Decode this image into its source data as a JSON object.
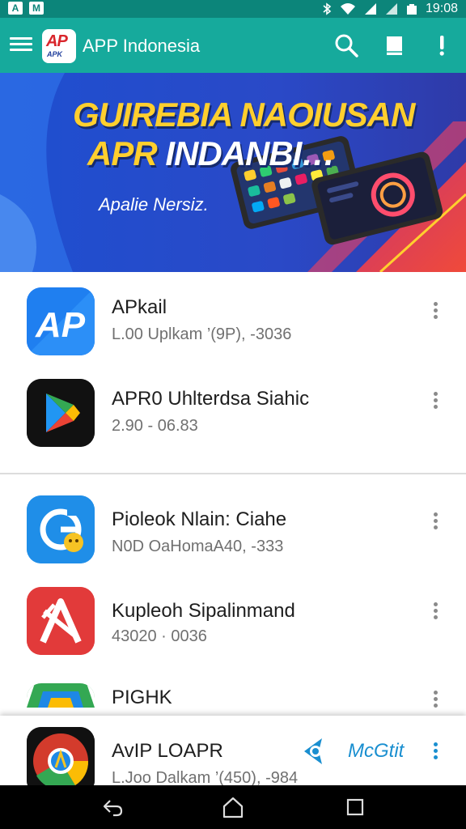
{
  "status_bar": {
    "left_glyphs": [
      "A",
      "M"
    ],
    "time": "19:08"
  },
  "app_bar": {
    "logo_text": "AP",
    "logo_subtext": "APK",
    "title": "APP Indonesia",
    "icons": [
      "menu-icon",
      "search-icon",
      "book-icon",
      "alert-icon"
    ]
  },
  "banner": {
    "line1": "GUIREBIA NAOIUSAN",
    "line2_a": "APR ",
    "line2_b": "INDANBI…",
    "subtitle": "Apalie Nersiz."
  },
  "apps": [
    {
      "name": "APkail",
      "meta": "L.00 Uplkam ’(9P), -3036",
      "icon": "ap-icon",
      "color": "#1f7ff0"
    },
    {
      "name": "APR0 Uhlterdsa Siahic",
      "meta": "2.90 - 06.83",
      "icon": "play-store-icon",
      "color": "#111111"
    },
    {
      "name": "Pioleok Nlain: Ciahe",
      "meta": "N0D OaHomaA40, -333",
      "icon": "g-emoji-icon",
      "color": "#1f8ee8"
    },
    {
      "name": "Kupleoh Sipalinmand",
      "meta": "43020 · 0036",
      "icon": "a-letter-icon",
      "color": "#e23a3a"
    },
    {
      "name": "PIGHK",
      "meta": "",
      "icon": "drive-icon",
      "color": "#34a853"
    },
    {
      "name": "AvIP LOAPR",
      "meta": "L.Joo Dalkam ’(450), -984",
      "icon": "chrome-like-icon",
      "color": "#d33b2c"
    }
  ],
  "bottom_strip": {
    "action_label": "McGtit"
  },
  "colors": {
    "status_bar": "#0c857a",
    "app_bar": "#16aa9c",
    "accent": "#1a8fd0"
  }
}
